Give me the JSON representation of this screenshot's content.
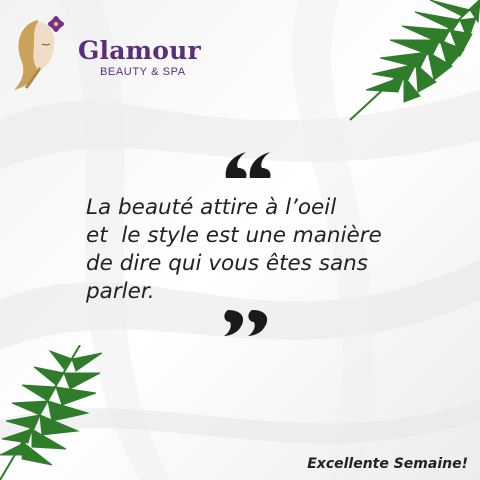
{
  "brand": {
    "name": "Glamour",
    "subtitle": "BEAUTY & SPA",
    "primary_color": "#5b2d7a",
    "logo_icon": "woman-face-flower-icon"
  },
  "quote": {
    "lines": [
      "La beauté attire à l’oeil",
      "et  le style est une manière",
      "de dire qui vous êtes sans",
      "parler."
    ],
    "open_icon": "open-quote-icon",
    "close_icon": "close-quote-icon"
  },
  "tagline": "Excellente Semaine!",
  "decor": {
    "background": "white silk fabric",
    "leaf_color": "#2f7d2a"
  }
}
